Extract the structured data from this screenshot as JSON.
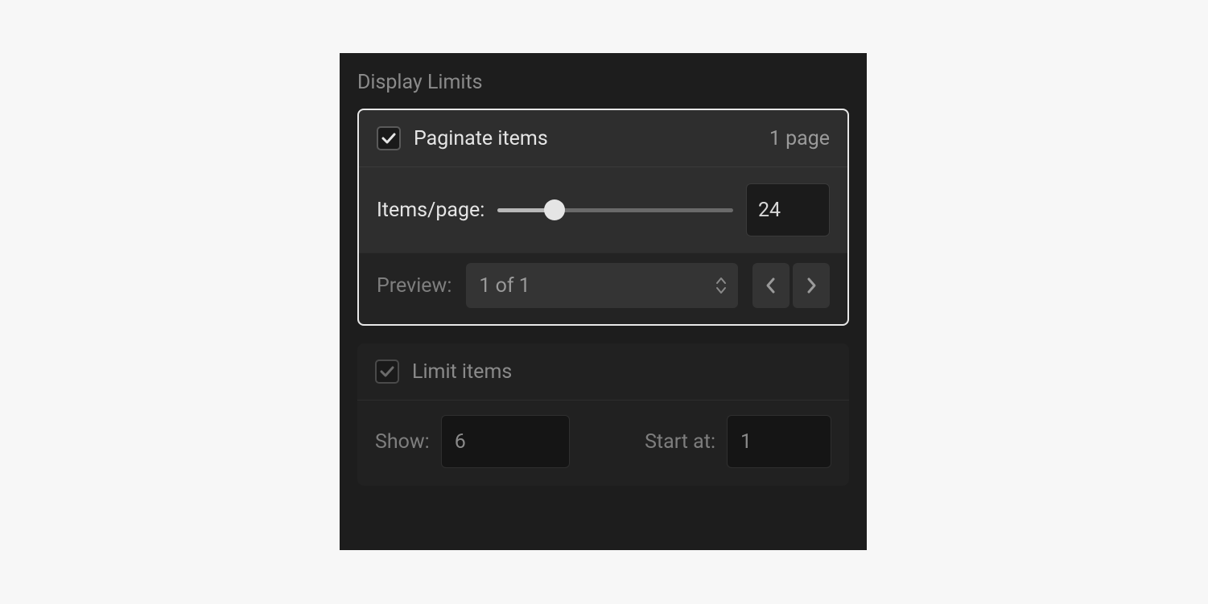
{
  "section_title": "Display Limits",
  "paginate": {
    "label": "Paginate items",
    "checked": true,
    "page_count_text": "1 page",
    "items_per_page_label": "Items/page:",
    "items_per_page_value": "24",
    "slider_percent": 24
  },
  "preview": {
    "label": "Preview:",
    "selected": "1 of 1"
  },
  "limit": {
    "label": "Limit items",
    "checked": true,
    "show_label": "Show:",
    "show_value": "6",
    "start_label": "Start at:",
    "start_value": "1"
  }
}
